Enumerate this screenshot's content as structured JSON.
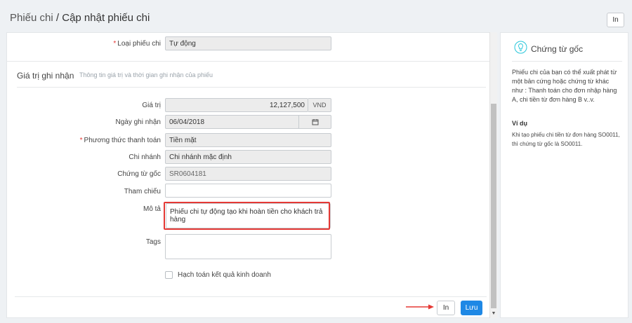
{
  "header": {
    "breadcrumb_parent": "Phiếu chi",
    "breadcrumb_separator": " / ",
    "page_title": "Cập nhật phiếu chi",
    "print_label": "In"
  },
  "form": {
    "loai_phieu_chi": {
      "label": "Loại phiếu chi",
      "value": "Tự động"
    },
    "section": {
      "title": "Giá trị ghi nhận",
      "subtitle": "Thông tin giá trị và thời gian ghi nhận của phiếu"
    },
    "gia_tri": {
      "label": "Giá trị",
      "value": "12,127,500",
      "unit": "VND"
    },
    "ngay_ghi_nhan": {
      "label": "Ngày ghi nhận",
      "value": "06/04/2018"
    },
    "phuong_thuc": {
      "label": "Phương thức thanh toán",
      "value": "Tiền mặt"
    },
    "chi_nhanh": {
      "label": "Chi nhánh",
      "value": "Chi nhánh mặc định"
    },
    "chung_tu_goc": {
      "label": "Chứng từ gốc",
      "value": "SR0604181"
    },
    "tham_chieu": {
      "label": "Tham chiếu",
      "value": ""
    },
    "mo_ta": {
      "label": "Mô tả",
      "value": "Phiếu chi tự động tạo khi hoàn tiền cho khách trả hàng"
    },
    "tags": {
      "label": "Tags",
      "value": ""
    },
    "hach_toan": {
      "label": "Hạch toán kết quả kinh doanh",
      "checked": false
    },
    "required_mark": "*"
  },
  "footer": {
    "print_label": "In",
    "save_label": "Lưu"
  },
  "side": {
    "title": "Chứng từ gốc",
    "description": "Phiếu chi của bạn có thể xuất phát từ một bản cứng hoặc chứng từ khác như : Thanh toán cho đơn nhập hàng A, chi tiền từ đơn hàng B v..v.",
    "example_title": "Ví dụ",
    "example_text": "Khi tạo phiếu chi tiền từ đơn hàng SO0011, thì chứng từ gốc là SO0011."
  },
  "colors": {
    "primary": "#1e88e5",
    "highlight": "#e53935",
    "required": "#e53935"
  },
  "icons": {
    "calendar": "calendar-icon",
    "bulb": "lightbulb-icon",
    "arrow": "arrow-right-icon"
  }
}
